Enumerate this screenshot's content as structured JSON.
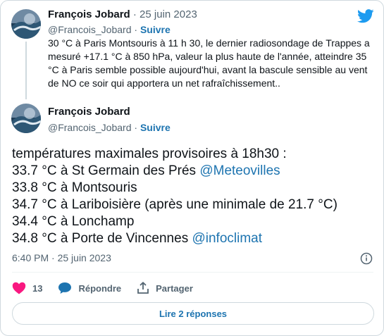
{
  "colors": {
    "accent": "#1d9bf0",
    "link": "#1d74b0",
    "like": "#f91880",
    "text": "#0f1419",
    "muted": "#536471",
    "border": "#cfd9de"
  },
  "logo_icon": "twitter-bird-icon",
  "reply_tweet": {
    "author": {
      "name": "François Jobard",
      "handle": "@Francois_Jobard"
    },
    "separator": "·",
    "date": "25 juin 2023",
    "dot": "·",
    "follow_label": "Suivre",
    "text": "30 °C à Paris Montsouris à 11 h 30, le dernier radiosondage de Trappes a mesuré +17.1 °C à 850 hPa, valeur la plus haute de l'année, atteindre 35 °C à Paris semble possible aujourd'hui, avant la bascule sensible au vent de NO ce soir qui apportera un net rafraîchissement.."
  },
  "main_tweet": {
    "author": {
      "name": "François Jobard",
      "handle": "@Francois_Jobard"
    },
    "dot": "·",
    "follow_label": "Suivre",
    "lines": [
      {
        "text": "températures maximales provisoires à 18h30 :",
        "mention": ""
      },
      {
        "text": "33.7 °C à St Germain des Prés ",
        "mention": "@Meteovilles"
      },
      {
        "text": "33.8 °C à Montsouris",
        "mention": ""
      },
      {
        "text": "34.7 °C à Lariboisière (après une minimale de 21.7 °C)",
        "mention": ""
      },
      {
        "text": "34.4 °C à Lonchamp",
        "mention": ""
      },
      {
        "text": "34.8 °C à Porte de Vincennes ",
        "mention": "@infoclimat"
      }
    ],
    "timestamp": "6:40 PM · 25 juin 2023"
  },
  "actions": {
    "like_count": "13",
    "reply_label": "Répondre",
    "share_label": "Partager"
  },
  "read_replies_label": "Lire 2 réponses"
}
